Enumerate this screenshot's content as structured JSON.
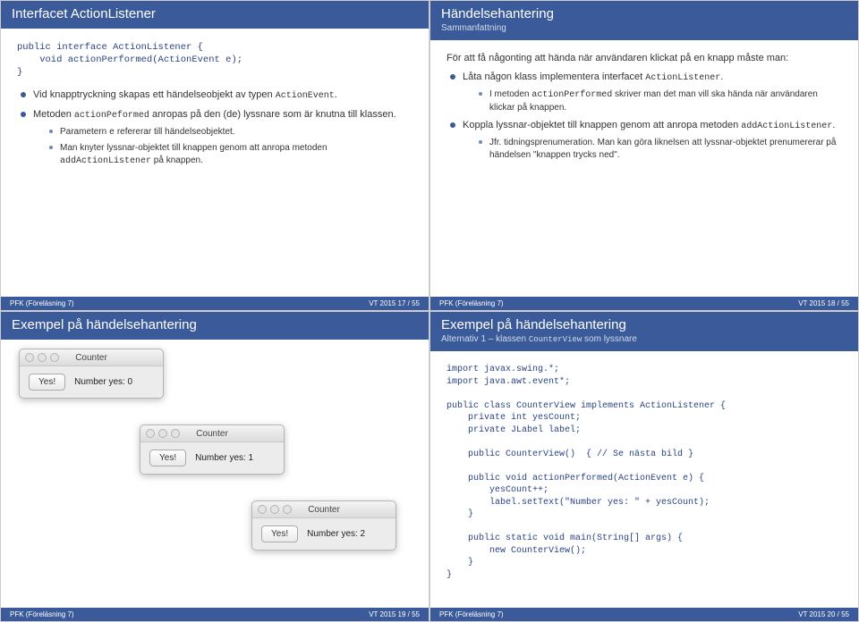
{
  "s17": {
    "title": "Interfacet ActionListener",
    "code": "public interface ActionListener {\n    void actionPerformed(ActionEvent e);\n}",
    "p1": "Vid knapptryckning skapas ett händelseobjekt av typen ",
    "p1m": "ActionEvent",
    "p1s": ".",
    "p2a": "Metoden ",
    "p2m": "actionPeformed",
    "p2b": " anropas på den (de) lyssnare som är knutna till klassen.",
    "sub1v": "Parametern ",
    "sub1m": "e",
    "sub1r": " refererar till händelseobjektet.",
    "sub2a": "Man knyter lyssnar-objektet till knappen genom att anropa metoden ",
    "sub2m": "addActionListener",
    "sub2b": " på knappen.",
    "fl": "PFK (Föreläsning 7)",
    "fr": "VT 2015    17 / 55"
  },
  "s18": {
    "title": "Händelsehantering",
    "subtitle": "Sammanfattning",
    "intro": "För att få någonting att hända när användaren klickat på en knapp måste man:",
    "b1a": "Låta någon klass implementera interfacet ",
    "b1m": "ActionListener",
    "b1s": ".",
    "b1sub_a": "I metoden ",
    "b1sub_m": "actionPerformed",
    "b1sub_b": " skriver man det man vill ska hända när användaren klickar på knappen.",
    "b2a": "Koppla lyssnar-objektet till knappen genom att anropa metoden ",
    "b2m": "addActionListener",
    "b2s": ".",
    "b2sub": "Jfr. tidningsprenumeration. Man kan göra liknelsen att lyssnar-objektet prenumererar på händelsen \"knappen trycks ned\".",
    "fl": "PFK (Föreläsning 7)",
    "fr": "VT 2015    18 / 55"
  },
  "s19": {
    "title": "Exempel på händelsehantering",
    "win_title": "Counter",
    "btn": "Yes!",
    "lab0": "Number yes: 0",
    "lab1": "Number yes: 1",
    "lab2": "Number yes: 2",
    "fl": "PFK (Föreläsning 7)",
    "fr": "VT 2015    19 / 55"
  },
  "s20": {
    "title": "Exempel på händelsehantering",
    "subtitle_a": "Alternativ 1 – klassen ",
    "subtitle_m": "CounterView",
    "subtitle_b": " som lyssnare",
    "code": "import javax.swing.*;\nimport java.awt.event*;\n\npublic class CounterView implements ActionListener {\n    private int yesCount;\n    private JLabel label;\n\n    public CounterView()  { // Se nästa bild }\n\n    public void actionPerformed(ActionEvent e) {\n        yesCount++;\n        label.setText(\"Number yes: \" + yesCount);\n    }\n\n    public static void main(String[] args) {\n        new CounterView();\n    }\n}",
    "fl": "PFK (Föreläsning 7)",
    "fr": "VT 2015    20 / 55"
  }
}
